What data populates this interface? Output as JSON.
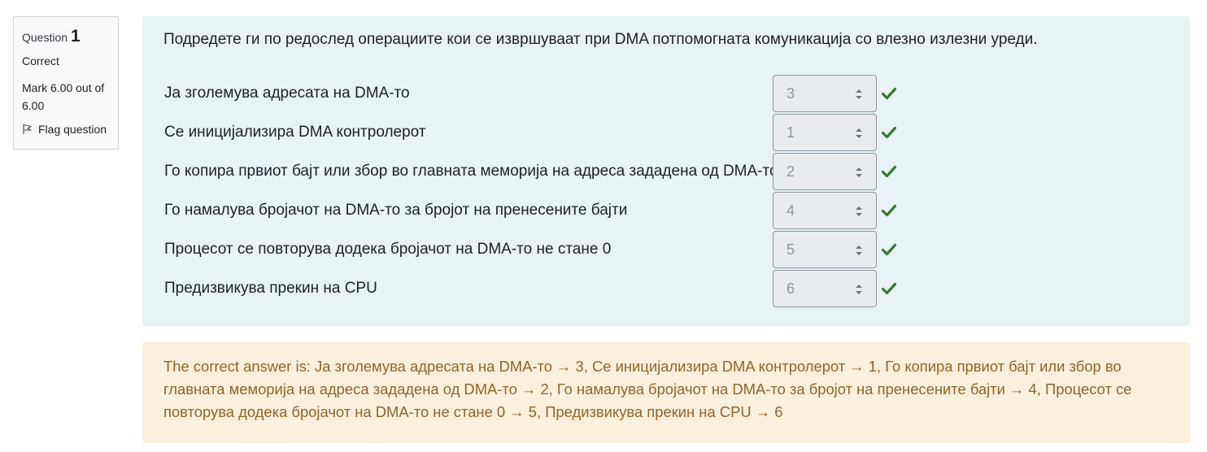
{
  "info": {
    "question_label": "Question",
    "question_number": "1",
    "state": "Correct",
    "grade": "Mark 6.00 out of 6.00",
    "flag_label": "Flag question",
    "flag_icon": "flag-outline-icon"
  },
  "question": {
    "text": "Подредете ги по редослед операциите кои се извршуваат при DMA потпомогната комуникација со влезно излезни уреди.",
    "rows": [
      {
        "stem": "Ја зголемува адресата на DMA-то",
        "selected": "3",
        "status": "correct"
      },
      {
        "stem": "Се иницијализира DMA контролерот",
        "selected": "1",
        "status": "correct"
      },
      {
        "stem": "Го копира првиот бајт или збор во главната меморија на адреса зададена од DMA-то",
        "selected": "2",
        "status": "correct"
      },
      {
        "stem": "Го намалува бројачот на DMA-то за бројот на пренесените бајти",
        "selected": "4",
        "status": "correct"
      },
      {
        "stem": "Процесот се повторува додека бројачот на DMA-то не стане 0",
        "selected": "5",
        "status": "correct"
      },
      {
        "stem": "Предизвикува прекин на CPU",
        "selected": "6",
        "status": "correct"
      }
    ]
  },
  "feedback": {
    "right_answer": "The correct answer is: Ја зголемува адресата на DMA-то → 3, Се иницијализира DMA контролерот → 1, Го копира првиот бајт или збор во главната меморија на адреса зададена од DMA-то → 2, Го намалува бројачот на DMA-то за бројот на пренесените бајти → 4, Процесот се повторува додека бројачот на DMA-то не стане 0 → 5, Предизвикува прекин на CPU → 6"
  },
  "colors": {
    "formulation_bg": "#e7f3f5",
    "outcome_bg": "#fcefdc",
    "outcome_text": "#8e662e",
    "correct_green": "#357a32"
  }
}
